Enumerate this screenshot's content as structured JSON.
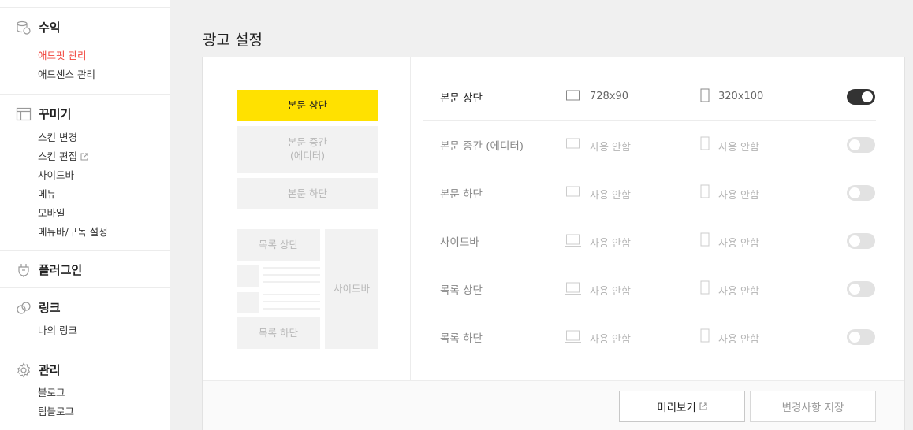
{
  "sidebar": {
    "sections": [
      {
        "title": "수익",
        "icon": "coins-icon",
        "items": [
          {
            "label": "애드핏 관리",
            "active": true
          },
          {
            "label": "애드센스 관리",
            "active": false
          }
        ]
      },
      {
        "title": "꾸미기",
        "icon": "layout-icon",
        "items": [
          {
            "label": "스킨 변경"
          },
          {
            "label": "스킨 편집"
          },
          {
            "label": "사이드바"
          },
          {
            "label": "메뉴"
          },
          {
            "label": "모바일"
          },
          {
            "label": "메뉴바/구독 설정"
          }
        ]
      },
      {
        "title": "플러그인",
        "icon": "plug-icon",
        "items": []
      },
      {
        "title": "링크",
        "icon": "link-icon",
        "items": [
          {
            "label": "나의 링크"
          }
        ]
      },
      {
        "title": "관리",
        "icon": "gear-icon",
        "items": [
          {
            "label": "블로그"
          },
          {
            "label": "팀블로그"
          }
        ]
      }
    ]
  },
  "main": {
    "title": "광고 설정",
    "preview": {
      "top": "본문 상단",
      "middle_1": "본문 중간",
      "middle_2": "(에디터)",
      "bottom": "본문 하단",
      "list_top": "목록 상단",
      "list_bottom": "목록 하단",
      "sidebar": "사이드바"
    },
    "rows": [
      {
        "label": "본문 상단",
        "pc": "728x90",
        "mobile": "320x100",
        "enabled": true
      },
      {
        "label": "본문 중간 (에디터)",
        "pc": "사용 안함",
        "mobile": "사용 안함",
        "enabled": false
      },
      {
        "label": "본문 하단",
        "pc": "사용 안함",
        "mobile": "사용 안함",
        "enabled": false
      },
      {
        "label": "사이드바",
        "pc": "사용 안함",
        "mobile": "사용 안함",
        "enabled": false
      },
      {
        "label": "목록 상단",
        "pc": "사용 안함",
        "mobile": "사용 안함",
        "enabled": false
      },
      {
        "label": "목록 하단",
        "pc": "사용 안함",
        "mobile": "사용 안함",
        "enabled": false
      }
    ],
    "buttons": {
      "preview": "미리보기",
      "save": "변경사항 저장"
    }
  },
  "colors": {
    "accent": "#f0443c",
    "highlight": "#ffe100",
    "toggle_on": "#333333"
  }
}
